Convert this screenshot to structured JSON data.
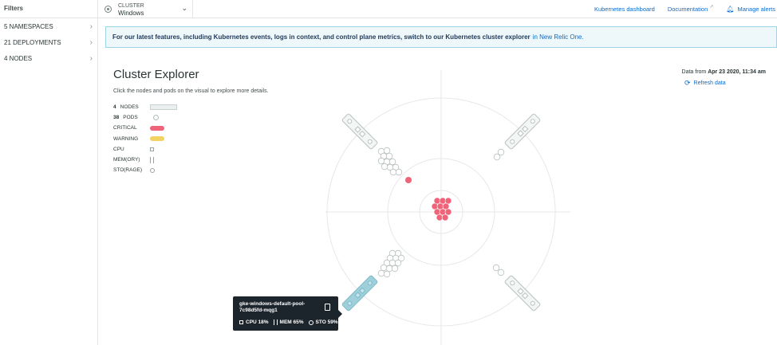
{
  "sidebar": {
    "header": "Filters",
    "items": [
      {
        "label": "5 NAMESPACES"
      },
      {
        "label": "21 DEPLOYMENTS"
      },
      {
        "label": "4 NODES"
      }
    ]
  },
  "topbar": {
    "cluster_label": "CLUSTER",
    "cluster_value": "Windows",
    "links": {
      "dashboard": "Kubernetes dashboard",
      "documentation": "Documentation",
      "alerts": "Manage alerts"
    }
  },
  "banner": {
    "text": "For our latest features, including Kubernetes events, logs in context, and control plane metrics, switch to our Kubernetes cluster explorer",
    "link": "in New Relic One."
  },
  "explorer": {
    "title": "Cluster Explorer",
    "subtitle": "Click the nodes and pods on the visual to explore more details.",
    "data_from_label": "Data from",
    "data_from_value": "Apr 23 2020, 11:34 am",
    "refresh": "Refresh data"
  },
  "legend": {
    "nodes_count": "4",
    "nodes_label": "NODES",
    "pods_count": "38",
    "pods_label": "PODS",
    "critical": "CRITICAL",
    "warning": "WARNING",
    "cpu": "CPU",
    "mem": "MEM(ORY)",
    "sto": "STO(RAGE)"
  },
  "colors": {
    "critical": "#f0647a",
    "warning": "#f2d261",
    "accent": "#0b6acb",
    "selected_node": "#9ed0dc"
  },
  "tooltip": {
    "name": "gke-windows-default-pool-7c98d5fd-mqg1",
    "cpu": "CPU 18%",
    "mem": "MEM 65%",
    "sto": "STO 59%"
  }
}
